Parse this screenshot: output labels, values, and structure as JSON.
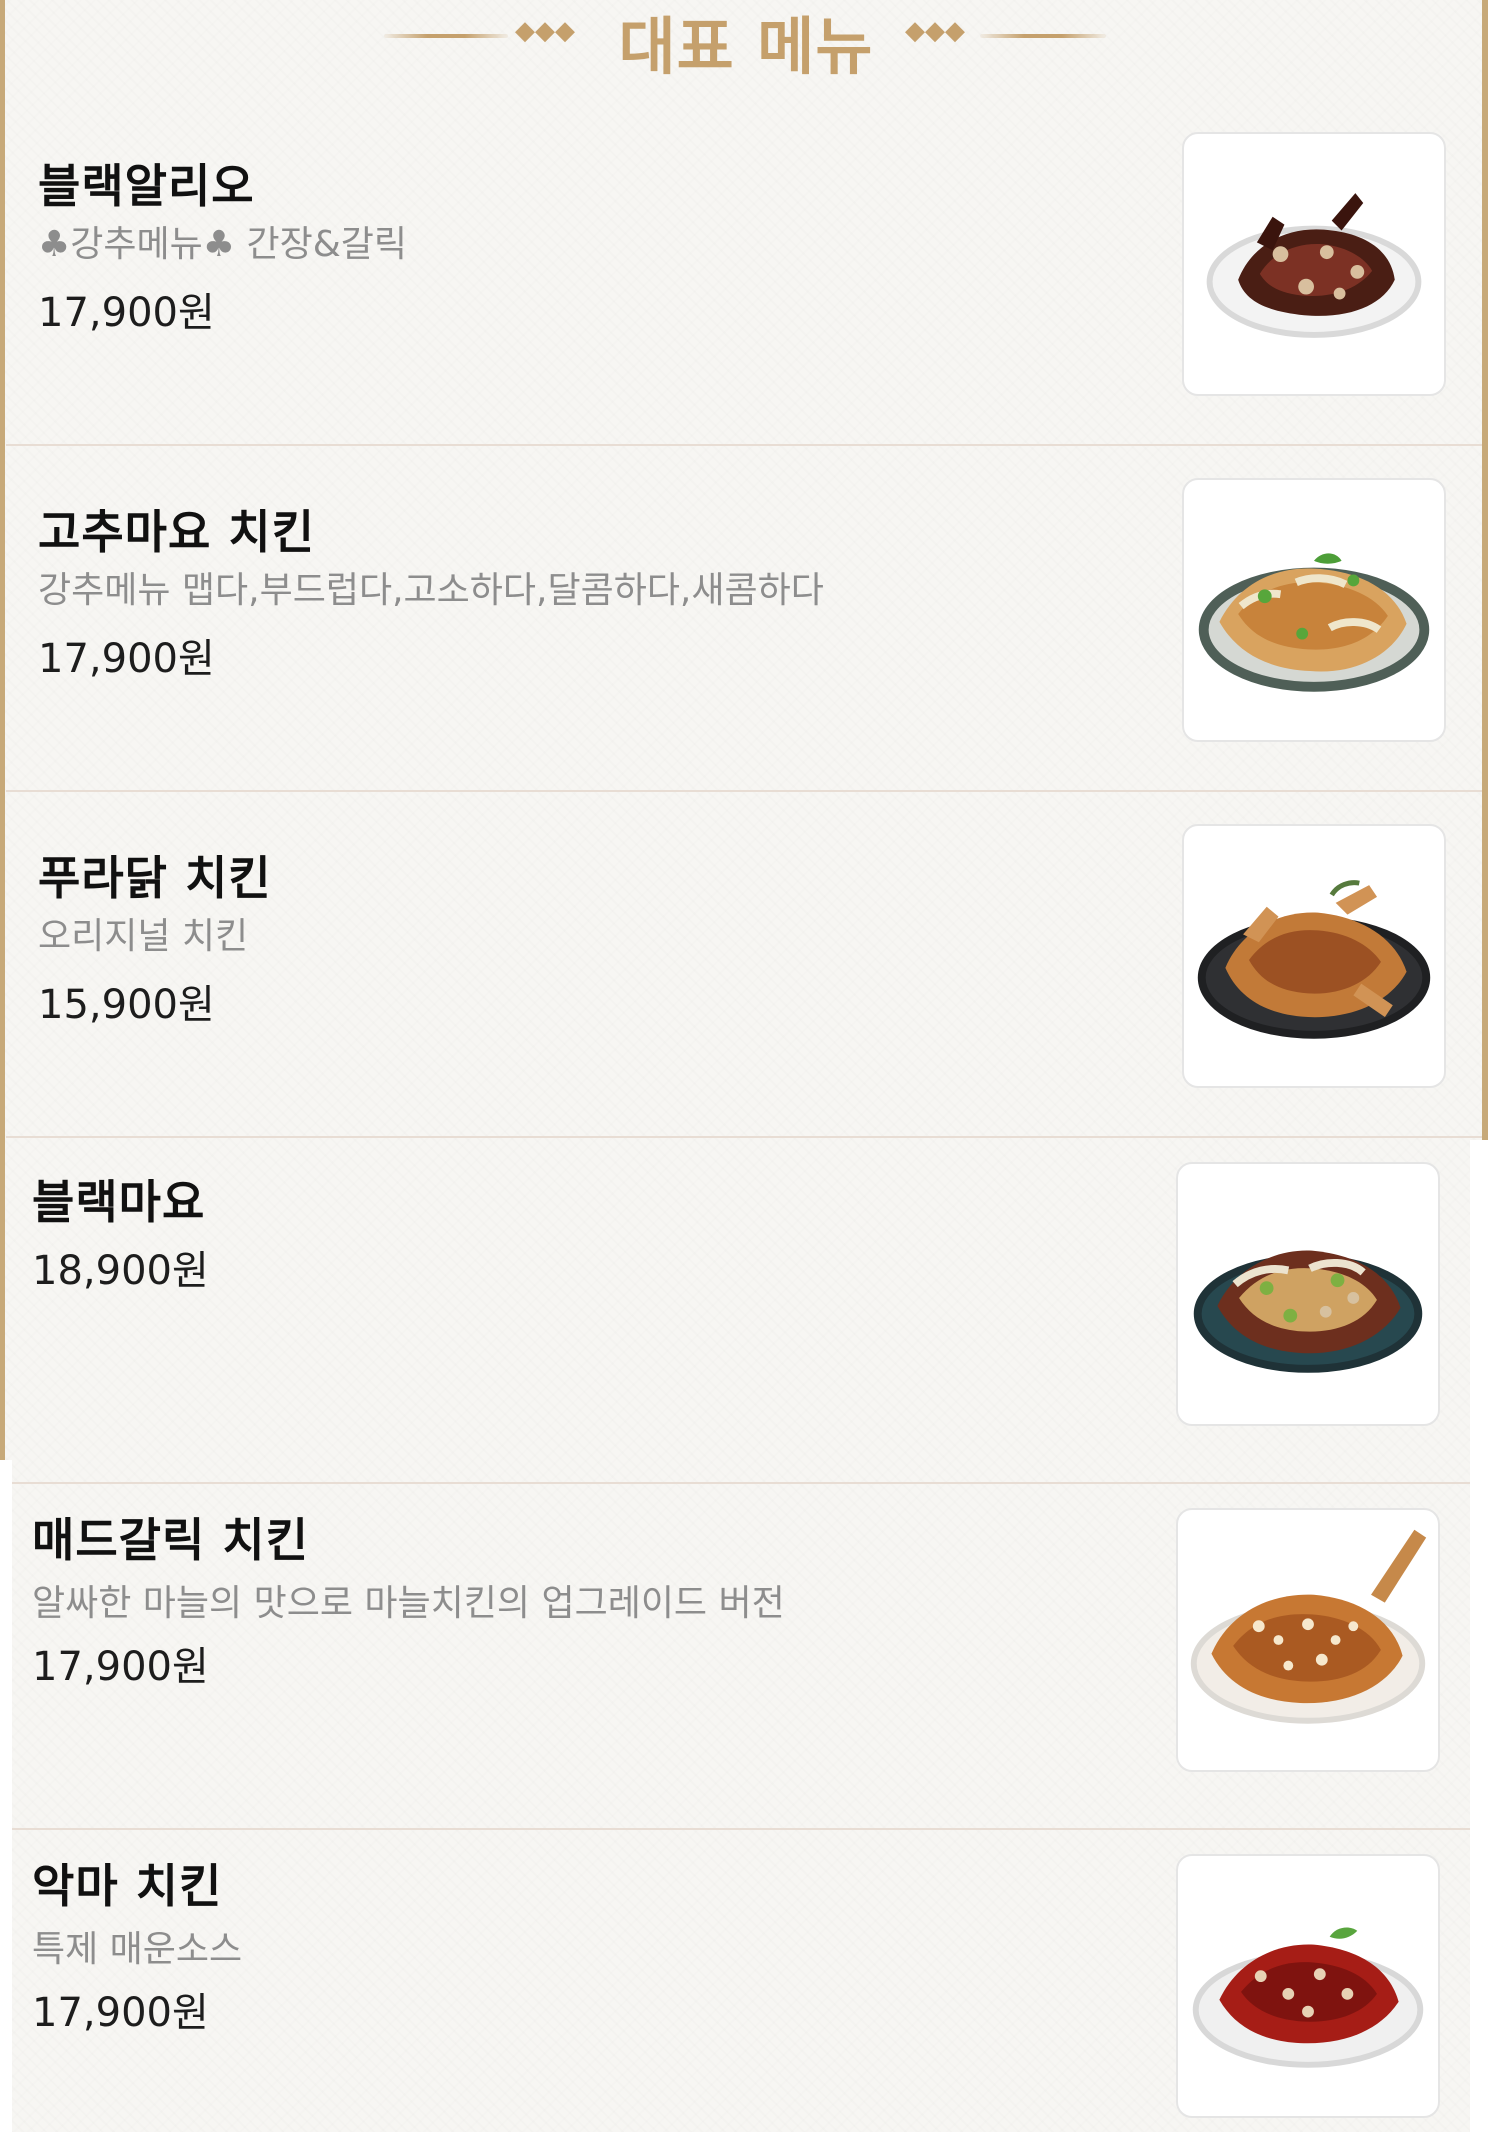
{
  "header": {
    "title": "대표 메뉴",
    "left_ornament": "◆◆◆",
    "right_ornament": "◆◆◆"
  },
  "items": [
    {
      "name": "블랙알리오",
      "description": "♣강추메뉴♣ 간장&갈릭",
      "price": "17,900원",
      "image": "black-alio-chicken-image"
    },
    {
      "name": "고추마요 치킨",
      "description": "강추메뉴  맵다,부드럽다,고소하다,달콤하다,새콤하다",
      "price": "17,900원",
      "image": "gochu-mayo-chicken-image"
    },
    {
      "name": "푸라닭 치킨",
      "description": "오리지널 치킨",
      "price": "15,900원",
      "image": "puradak-chicken-image"
    },
    {
      "name": "블랙마요",
      "description": "",
      "price": "18,900원",
      "image": "black-mayo-chicken-image"
    },
    {
      "name": "매드갈릭 치킨",
      "description": "알싸한 마늘의 맛으로 마늘치킨의 업그레이드 버전",
      "price": "17,900원",
      "image": "mad-garlic-chicken-image"
    },
    {
      "name": "악마 치킨",
      "description": "특제 매운소스",
      "price": "17,900원",
      "image": "devil-chicken-image"
    }
  ]
}
